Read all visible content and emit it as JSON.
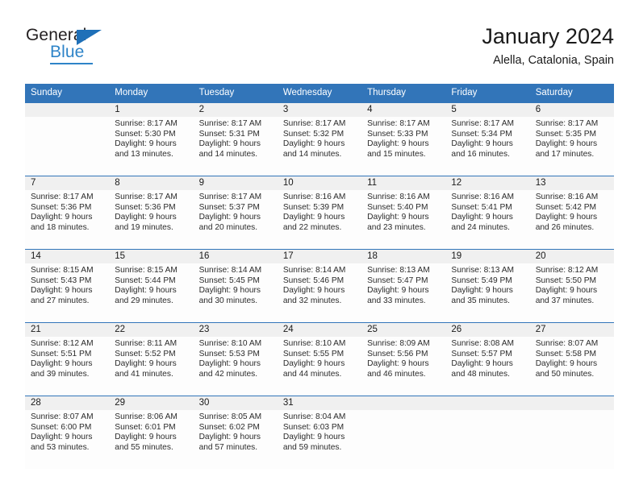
{
  "brand": {
    "name_top": "General",
    "name_bottom": "Blue",
    "triangle_icon": "logo-triangle-icon",
    "accent_color": "#2e84c8"
  },
  "header": {
    "title": "January 2024",
    "subtitle": "Alella, Catalonia, Spain"
  },
  "theme": {
    "header_bg": "#3275b9",
    "header_text": "#ffffff",
    "daynum_band_bg": "#f0f0f0",
    "cell_bg": "#fdfdfd",
    "grid_line": "#3275b9"
  },
  "calendar": {
    "weekday_headers": [
      "Sunday",
      "Monday",
      "Tuesday",
      "Wednesday",
      "Thursday",
      "Friday",
      "Saturday"
    ],
    "weeks": [
      [
        {
          "day": "",
          "sunrise": "",
          "sunset": "",
          "daylight_line1": "",
          "daylight_line2": ""
        },
        {
          "day": "1",
          "sunrise": "Sunrise: 8:17 AM",
          "sunset": "Sunset: 5:30 PM",
          "daylight_line1": "Daylight: 9 hours",
          "daylight_line2": "and 13 minutes."
        },
        {
          "day": "2",
          "sunrise": "Sunrise: 8:17 AM",
          "sunset": "Sunset: 5:31 PM",
          "daylight_line1": "Daylight: 9 hours",
          "daylight_line2": "and 14 minutes."
        },
        {
          "day": "3",
          "sunrise": "Sunrise: 8:17 AM",
          "sunset": "Sunset: 5:32 PM",
          "daylight_line1": "Daylight: 9 hours",
          "daylight_line2": "and 14 minutes."
        },
        {
          "day": "4",
          "sunrise": "Sunrise: 8:17 AM",
          "sunset": "Sunset: 5:33 PM",
          "daylight_line1": "Daylight: 9 hours",
          "daylight_line2": "and 15 minutes."
        },
        {
          "day": "5",
          "sunrise": "Sunrise: 8:17 AM",
          "sunset": "Sunset: 5:34 PM",
          "daylight_line1": "Daylight: 9 hours",
          "daylight_line2": "and 16 minutes."
        },
        {
          "day": "6",
          "sunrise": "Sunrise: 8:17 AM",
          "sunset": "Sunset: 5:35 PM",
          "daylight_line1": "Daylight: 9 hours",
          "daylight_line2": "and 17 minutes."
        }
      ],
      [
        {
          "day": "7",
          "sunrise": "Sunrise: 8:17 AM",
          "sunset": "Sunset: 5:36 PM",
          "daylight_line1": "Daylight: 9 hours",
          "daylight_line2": "and 18 minutes."
        },
        {
          "day": "8",
          "sunrise": "Sunrise: 8:17 AM",
          "sunset": "Sunset: 5:36 PM",
          "daylight_line1": "Daylight: 9 hours",
          "daylight_line2": "and 19 minutes."
        },
        {
          "day": "9",
          "sunrise": "Sunrise: 8:17 AM",
          "sunset": "Sunset: 5:37 PM",
          "daylight_line1": "Daylight: 9 hours",
          "daylight_line2": "and 20 minutes."
        },
        {
          "day": "10",
          "sunrise": "Sunrise: 8:16 AM",
          "sunset": "Sunset: 5:39 PM",
          "daylight_line1": "Daylight: 9 hours",
          "daylight_line2": "and 22 minutes."
        },
        {
          "day": "11",
          "sunrise": "Sunrise: 8:16 AM",
          "sunset": "Sunset: 5:40 PM",
          "daylight_line1": "Daylight: 9 hours",
          "daylight_line2": "and 23 minutes."
        },
        {
          "day": "12",
          "sunrise": "Sunrise: 8:16 AM",
          "sunset": "Sunset: 5:41 PM",
          "daylight_line1": "Daylight: 9 hours",
          "daylight_line2": "and 24 minutes."
        },
        {
          "day": "13",
          "sunrise": "Sunrise: 8:16 AM",
          "sunset": "Sunset: 5:42 PM",
          "daylight_line1": "Daylight: 9 hours",
          "daylight_line2": "and 26 minutes."
        }
      ],
      [
        {
          "day": "14",
          "sunrise": "Sunrise: 8:15 AM",
          "sunset": "Sunset: 5:43 PM",
          "daylight_line1": "Daylight: 9 hours",
          "daylight_line2": "and 27 minutes."
        },
        {
          "day": "15",
          "sunrise": "Sunrise: 8:15 AM",
          "sunset": "Sunset: 5:44 PM",
          "daylight_line1": "Daylight: 9 hours",
          "daylight_line2": "and 29 minutes."
        },
        {
          "day": "16",
          "sunrise": "Sunrise: 8:14 AM",
          "sunset": "Sunset: 5:45 PM",
          "daylight_line1": "Daylight: 9 hours",
          "daylight_line2": "and 30 minutes."
        },
        {
          "day": "17",
          "sunrise": "Sunrise: 8:14 AM",
          "sunset": "Sunset: 5:46 PM",
          "daylight_line1": "Daylight: 9 hours",
          "daylight_line2": "and 32 minutes."
        },
        {
          "day": "18",
          "sunrise": "Sunrise: 8:13 AM",
          "sunset": "Sunset: 5:47 PM",
          "daylight_line1": "Daylight: 9 hours",
          "daylight_line2": "and 33 minutes."
        },
        {
          "day": "19",
          "sunrise": "Sunrise: 8:13 AM",
          "sunset": "Sunset: 5:49 PM",
          "daylight_line1": "Daylight: 9 hours",
          "daylight_line2": "and 35 minutes."
        },
        {
          "day": "20",
          "sunrise": "Sunrise: 8:12 AM",
          "sunset": "Sunset: 5:50 PM",
          "daylight_line1": "Daylight: 9 hours",
          "daylight_line2": "and 37 minutes."
        }
      ],
      [
        {
          "day": "21",
          "sunrise": "Sunrise: 8:12 AM",
          "sunset": "Sunset: 5:51 PM",
          "daylight_line1": "Daylight: 9 hours",
          "daylight_line2": "and 39 minutes."
        },
        {
          "day": "22",
          "sunrise": "Sunrise: 8:11 AM",
          "sunset": "Sunset: 5:52 PM",
          "daylight_line1": "Daylight: 9 hours",
          "daylight_line2": "and 41 minutes."
        },
        {
          "day": "23",
          "sunrise": "Sunrise: 8:10 AM",
          "sunset": "Sunset: 5:53 PM",
          "daylight_line1": "Daylight: 9 hours",
          "daylight_line2": "and 42 minutes."
        },
        {
          "day": "24",
          "sunrise": "Sunrise: 8:10 AM",
          "sunset": "Sunset: 5:55 PM",
          "daylight_line1": "Daylight: 9 hours",
          "daylight_line2": "and 44 minutes."
        },
        {
          "day": "25",
          "sunrise": "Sunrise: 8:09 AM",
          "sunset": "Sunset: 5:56 PM",
          "daylight_line1": "Daylight: 9 hours",
          "daylight_line2": "and 46 minutes."
        },
        {
          "day": "26",
          "sunrise": "Sunrise: 8:08 AM",
          "sunset": "Sunset: 5:57 PM",
          "daylight_line1": "Daylight: 9 hours",
          "daylight_line2": "and 48 minutes."
        },
        {
          "day": "27",
          "sunrise": "Sunrise: 8:07 AM",
          "sunset": "Sunset: 5:58 PM",
          "daylight_line1": "Daylight: 9 hours",
          "daylight_line2": "and 50 minutes."
        }
      ],
      [
        {
          "day": "28",
          "sunrise": "Sunrise: 8:07 AM",
          "sunset": "Sunset: 6:00 PM",
          "daylight_line1": "Daylight: 9 hours",
          "daylight_line2": "and 53 minutes."
        },
        {
          "day": "29",
          "sunrise": "Sunrise: 8:06 AM",
          "sunset": "Sunset: 6:01 PM",
          "daylight_line1": "Daylight: 9 hours",
          "daylight_line2": "and 55 minutes."
        },
        {
          "day": "30",
          "sunrise": "Sunrise: 8:05 AM",
          "sunset": "Sunset: 6:02 PM",
          "daylight_line1": "Daylight: 9 hours",
          "daylight_line2": "and 57 minutes."
        },
        {
          "day": "31",
          "sunrise": "Sunrise: 8:04 AM",
          "sunset": "Sunset: 6:03 PM",
          "daylight_line1": "Daylight: 9 hours",
          "daylight_line2": "and 59 minutes."
        },
        {
          "day": "",
          "sunrise": "",
          "sunset": "",
          "daylight_line1": "",
          "daylight_line2": ""
        },
        {
          "day": "",
          "sunrise": "",
          "sunset": "",
          "daylight_line1": "",
          "daylight_line2": ""
        },
        {
          "day": "",
          "sunrise": "",
          "sunset": "",
          "daylight_line1": "",
          "daylight_line2": ""
        }
      ]
    ]
  }
}
